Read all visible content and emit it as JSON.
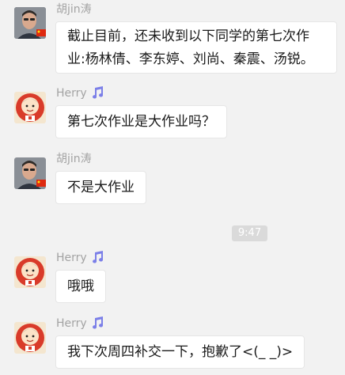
{
  "messages": [
    {
      "sender": "胡jin涛",
      "avatar_icon": "man-portrait-with-china-flag-icon",
      "lines": [
        "截止目前，还未收到以下同学的第七次作",
        "业:杨林倩、李东婷、刘尚、秦震、汤锐。"
      ]
    },
    {
      "sender": "Herry",
      "avatar_icon": "cartoon-boy-avatar-icon",
      "badge_icon": "music-note-icon",
      "text": "第七次作业是大作业吗？"
    },
    {
      "sender": "胡jin涛",
      "avatar_icon": "man-portrait-with-china-flag-icon",
      "text": "不是大作业"
    },
    {
      "sender": "Herry",
      "avatar_icon": "cartoon-boy-avatar-icon",
      "badge_icon": "music-note-icon",
      "text": "哦哦"
    },
    {
      "sender": "Herry",
      "avatar_icon": "cartoon-boy-avatar-icon",
      "badge_icon": "music-note-icon",
      "text": "我下次周四补交一下，抱歉了<(_ _)>"
    }
  ],
  "timestamp": "9:47",
  "colors": {
    "background": "#f2f2f2",
    "bubble": "#ffffff",
    "name": "#a3a3a3",
    "badge": "#7b7fe8",
    "timestamp_bg": "#dadada"
  }
}
